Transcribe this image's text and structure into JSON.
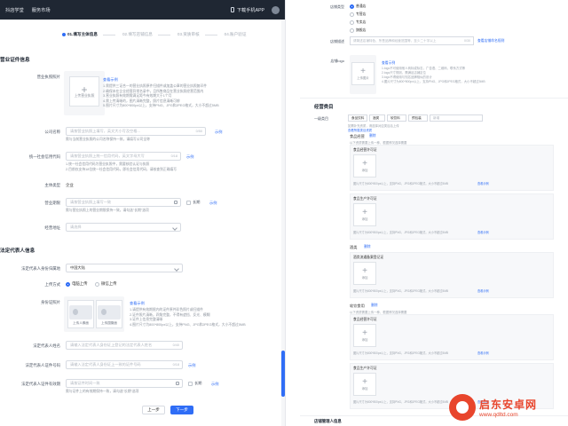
{
  "topbar": {
    "nav": [
      "抖店学堂",
      "服务市场"
    ],
    "download": "下载手机APP"
  },
  "steps": [
    "01.填写主体信息",
    "02.填写店铺信息",
    "03.资质审核",
    "04.账户验证"
  ],
  "license": {
    "section": "营业证件信息",
    "photo_label": "营业执照照片",
    "upload_text": "上传营业执照",
    "example": "查看示例",
    "rules": [
      "1.需提供三证合一的营业执照原件扫描件或加盖公章的营业执照复印件",
      "2.确保未在企业经营异常名录中，且所售商品在营业执照经营范围内",
      "3.营业执照有效期需满足距今有效期大于1个月",
      "4.需上传清晰的，图片清晰完整，照片信息清晰可辨",
      "5.图片尺寸为800*800px以上，支持PNG、JPG和JPEG格式，大小不超过5MB"
    ],
    "company_label": "公司名称",
    "company_ph": "请按营业执照上填写，英文大小写及空格...",
    "company_count": "0/50",
    "company_example": "示例",
    "company_hint": "需与当前营业执照的公司名称保持一致，请填写公司全称",
    "credit_label": "统一社会信用代码",
    "credit_ph": "请按营业执照上统一信用代码，英文字母大写",
    "credit_count": "0/18",
    "credit_example": "示例",
    "credit_hint1": "1.统一社会信用代码为营业执照中，需要核验认证与执照",
    "credit_hint2": "2.目前仅支持18位统一社会信用代码，即社会信用代码，请核查到正确填写",
    "subject_label": "主体类型",
    "subject_value": "企业",
    "period_label": "营业期限",
    "period_ph": "请按营业执照上填写一致",
    "period_long": "长期",
    "period_example": "示例",
    "period_hint": "需与营业执照上的营业期限保持一致，请勾选\"长期\"选项",
    "address_label": "经营地址",
    "address_ph": "请选择"
  },
  "legal": {
    "section": "法定代表人信息",
    "region_label": "法定代表人身份归属地",
    "region_value": "中国大陆",
    "method_label": "上传方式",
    "method_pc": "电脑上传",
    "method_mobile": "微信上传",
    "id_label": "身份证照片",
    "front_text": "上传人像面",
    "back_text": "上传国徽面",
    "example": "查看示例",
    "id_rules": [
      "1.请提供有效期限内的证件原件彩色照片或扫描件",
      "2.证件照片清晰，四角完整，不得有遮挡、反光、模糊",
      "3.证件上信息完整清晰",
      "4.图片尺寸为800*800px以上，支持PNG、JPG和JPEG格式，大小不超过5MB"
    ],
    "name_label": "法定代表人姓名",
    "name_ph": "请输入法定代表人身份证上登记的法定代表人姓名",
    "name_count": "0/40",
    "idno_label": "法定代表人证件号码",
    "idno_ph": "请输入法定代表人身份证上一致的证件号码",
    "idno_count": "0/18",
    "idno_example": "示例",
    "validity_label": "法定代表人证件有效期",
    "validity_ph": "请按证件时间一致",
    "validity_long": "长期",
    "validity_example": "示例",
    "validity_hint": "需与证件上的有效期保持一致，请勾选\"长期\"选项"
  },
  "buttons": {
    "prev": "上一步",
    "next": "下一步"
  },
  "right": {
    "store_type_label": "店铺类型",
    "store_types": [
      "普通店",
      "专营店",
      "专卖店",
      "旗舰店"
    ],
    "store_desc_label": "店铺描述",
    "store_desc_ph": "请简述店铺特色、所售品牌和经营范围等，至少二十字以上",
    "store_desc_count": "0/30",
    "store_desc_link": "查看店铺命名规则",
    "logo_label": "店铺logo",
    "logo_upload": "上传图片",
    "logo_example": "查看示例",
    "logo_rules": [
      "1.logo不可使用他人商标或标志，广告语、二维码、联系方式等",
      "2.logo尺寸规则，需满足店铺定位",
      "3.logo不得使用与知名品牌相似的设计",
      "4.图片尺寸为800*800px以上，支持PNG、JPG和JPEG格式，大小不超过5MB"
    ],
    "qual_section": "经营类目",
    "category_label": "一级类目",
    "category_values": [
      "食品饮料",
      "酒类",
      "软饮料",
      "预包装",
      "新增"
    ],
    "category_hint": "如需补充资质，请选择对应类目后上传",
    "category_link": "查看所属类目资质",
    "subgroups": [
      {
        "title": "食品经营",
        "link": "删除",
        "sub": "以下资质需要上传一种，根据情况选择需要",
        "cards": [
          {
            "title": "食品经营许可证",
            "upload": "添加",
            "note": "图片尺寸为800*800px以上，支持PNG、JPG和JPEG格式，大小不超过5MB",
            "example": "查看示例"
          },
          {
            "title": "食品生产许可证",
            "upload": "添加",
            "note": "图片尺寸为800*800px以上，支持PNG、JPG和JPEG格式，大小不超过5MB",
            "example": "查看示例"
          }
        ]
      },
      {
        "title": "酒类",
        "link": "删除",
        "sub": "",
        "cards": [
          {
            "title": "酒类流通备案登记证",
            "upload": "添加",
            "note": "图片尺寸为800*800px以上，支持PNG、JPG和JPEG格式，大小不超过5MB",
            "example": "查看示例"
          }
        ]
      },
      {
        "title": "软饮食用",
        "link": "删除",
        "sub": "以下资质需要上传一种，根据情况选择需要",
        "cards": [
          {
            "title": "食品经营许可证",
            "upload": "添加",
            "note": "图片尺寸为800*800px以上，支持PNG、JPG和JPEG格式，大小不超过5MB",
            "example": "查看示例"
          },
          {
            "title": "食品生产许可证",
            "upload": "添加",
            "note": "图片尺寸为800*800px以上，支持PNG、JPG和JPEG格式，大小不超过5MB",
            "example": "查看示例"
          }
        ]
      }
    ],
    "bottom_section": "店铺管理人信息"
  },
  "watermark": {
    "line1": "启东安卓网",
    "line2": "www.qdltd.com"
  },
  "colors": {
    "accent": "#2f6df6",
    "topbar": "#1f2733",
    "watermark": "#e8452c"
  }
}
